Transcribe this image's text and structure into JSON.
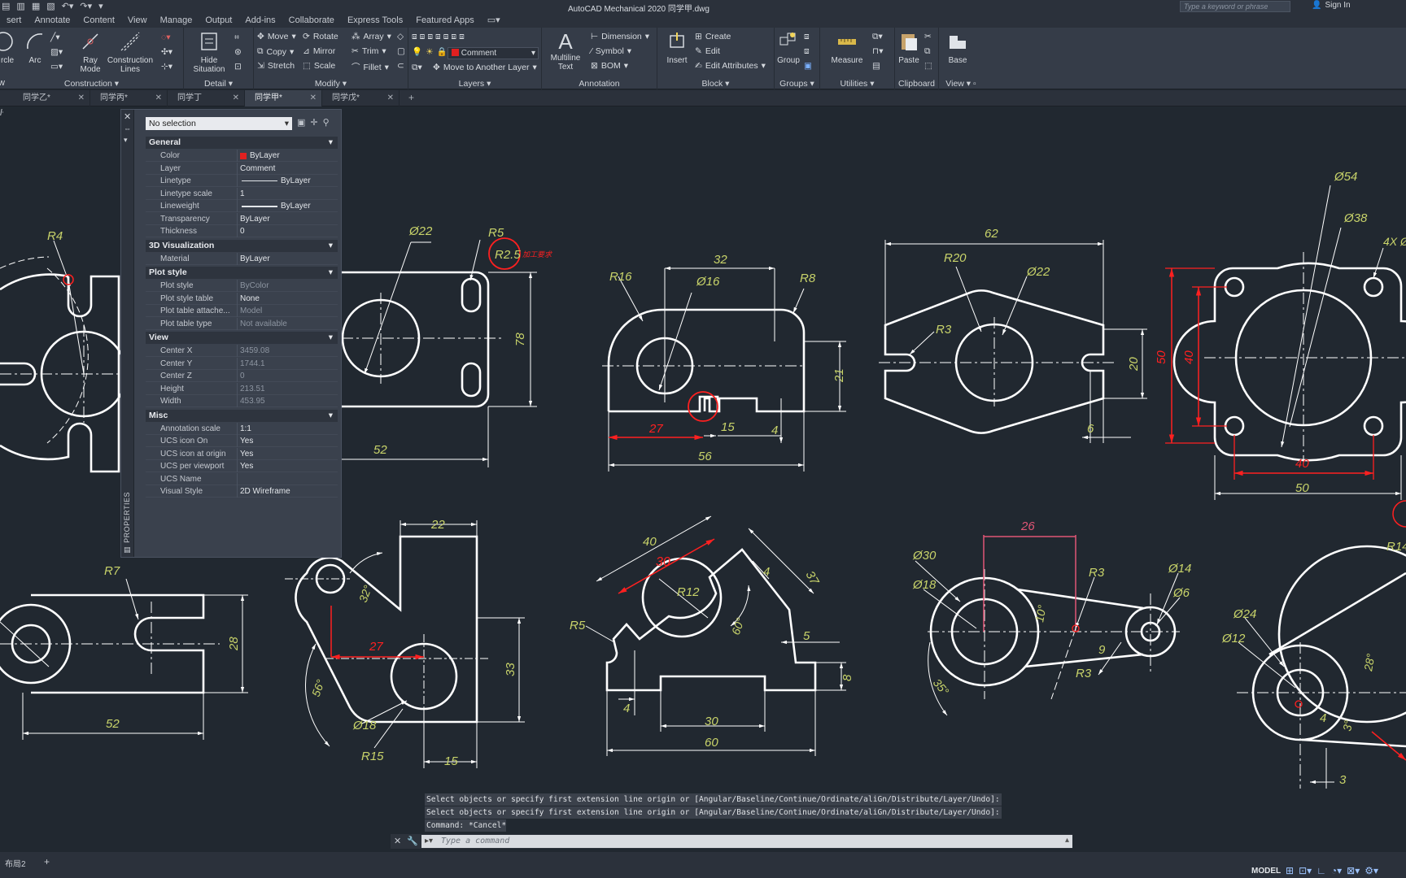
{
  "titlebar": {
    "title": "AutoCAD Mechanical 2020    同学甲.dwg",
    "search_placeholder": "Type a keyword or phrase",
    "signin": "Sign In"
  },
  "menu_tabs": [
    "sert",
    "Annotate",
    "Content",
    "View",
    "Manage",
    "Output",
    "Add-ins",
    "Collaborate",
    "Express Tools",
    "Featured Apps"
  ],
  "ribbon": {
    "construction": {
      "title": "Construction",
      "circle": "rcle",
      "arc": "Arc",
      "ray": "Ray\nMode",
      "lines": "Construction\nLines"
    },
    "detail": {
      "title": "Detail",
      "hide": "Hide\nSituation"
    },
    "modify": {
      "title": "Modify",
      "move": "Move",
      "rotate": "Rotate",
      "array": "Array",
      "copy": "Copy",
      "mirror": "Mirror",
      "trim": "Trim",
      "stretch": "Stretch",
      "scale": "Scale",
      "fillet": "Fillet"
    },
    "layers": {
      "title": "Layers",
      "current": "Comment",
      "move_layer": "Move to Another Layer"
    },
    "annotation": {
      "title": "Annotation",
      "mtext": "Multiline\nText",
      "dimension": "Dimension",
      "symbol": "Symbol",
      "bom": "BOM"
    },
    "block": {
      "title": "Block",
      "insert": "Insert",
      "create": "Create",
      "edit": "Edit",
      "edit_attr": "Edit Attributes"
    },
    "groups": {
      "title": "Groups",
      "group": "Group"
    },
    "utilities": {
      "title": "Utilities",
      "measure": "Measure"
    },
    "clipboard": {
      "title": "Clipboard",
      "paste": "Paste"
    },
    "view": {
      "title": "View",
      "base": "Base"
    },
    "left_label": "w"
  },
  "doc_tabs": [
    {
      "label": "同学乙*",
      "active": false
    },
    {
      "label": "同学丙*",
      "active": false
    },
    {
      "label": "同学丁",
      "active": false
    },
    {
      "label": "同学甲*",
      "active": true
    },
    {
      "label": "同学戊*",
      "active": false
    }
  ],
  "properties": {
    "selection": "No selection",
    "side_label": "PROPERTIES",
    "general": {
      "title": "General",
      "rows": [
        {
          "k": "Color",
          "v": "ByLayer"
        },
        {
          "k": "Layer",
          "v": "Comment"
        },
        {
          "k": "Linetype",
          "v": "ByLayer"
        },
        {
          "k": "Linetype scale",
          "v": "1"
        },
        {
          "k": "Lineweight",
          "v": "ByLayer"
        },
        {
          "k": "Transparency",
          "v": "ByLayer"
        },
        {
          "k": "Thickness",
          "v": "0"
        }
      ]
    },
    "viz": {
      "title": "3D Visualization",
      "rows": [
        {
          "k": "Material",
          "v": "ByLayer"
        }
      ]
    },
    "plot": {
      "title": "Plot style",
      "rows": [
        {
          "k": "Plot style",
          "v": "ByColor"
        },
        {
          "k": "Plot style table",
          "v": "None"
        },
        {
          "k": "Plot table attache...",
          "v": "Model"
        },
        {
          "k": "Plot table type",
          "v": "Not available"
        }
      ]
    },
    "view": {
      "title": "View",
      "rows": [
        {
          "k": "Center X",
          "v": "3459.08"
        },
        {
          "k": "Center Y",
          "v": "1744.1"
        },
        {
          "k": "Center Z",
          "v": "0"
        },
        {
          "k": "Height",
          "v": "213.51"
        },
        {
          "k": "Width",
          "v": "453.95"
        }
      ]
    },
    "misc": {
      "title": "Misc",
      "rows": [
        {
          "k": "Annotation scale",
          "v": "1:1"
        },
        {
          "k": "UCS icon On",
          "v": "Yes"
        },
        {
          "k": "UCS icon at origin",
          "v": "Yes"
        },
        {
          "k": "UCS per viewport",
          "v": "Yes"
        },
        {
          "k": "UCS Name",
          "v": ""
        },
        {
          "k": "Visual Style",
          "v": "2D Wireframe"
        }
      ]
    }
  },
  "command": {
    "history": [
      "Select objects or specify first extension line origin or [Angular/Baseline/Continue/Ordinate/aliGn/Distribute/Layer/Undo]:",
      "Select objects or specify first extension line origin or [Angular/Baseline/Continue/Ordinate/aliGn/Distribute/Layer/Undo]:",
      "Command: *Cancel*"
    ],
    "placeholder": "Type a command"
  },
  "statusbar": {
    "layout": "布局2",
    "model": "MODEL"
  },
  "dims": {
    "d1": {
      "r4": "R4"
    },
    "d2": {
      "d22": "Ø22",
      "r5": "R5",
      "r25": "R2.5",
      "h78": "78",
      "w52": "52",
      "note": "加工要求"
    },
    "d3": {
      "w32": "32",
      "r16": "R16",
      "d16": "Ø16",
      "r8": "R8",
      "h21": "21",
      "w27": "27",
      "w15": "15",
      "h4": "4",
      "w56": "56"
    },
    "d4": {
      "w62": "62",
      "r20": "R20",
      "d22": "Ø22",
      "r3": "R3",
      "h20": "20",
      "w6": "6"
    },
    "d5": {
      "d54": "Ø54",
      "d38": "Ø38",
      "n4x": "4X Ø",
      "h50": "50",
      "h40": "40",
      "w40": "40",
      "w50": "50"
    },
    "d6": {
      "r7": "R7",
      "h28": "28",
      "w52": "52"
    },
    "d7": {
      "w22": "22",
      "a32": "32°",
      "w27": "27",
      "h33": "33",
      "a56": "56°",
      "d18": "Ø18",
      "r15": "R15",
      "w15": "15"
    },
    "d8": {
      "w40": "40",
      "w30r": "30",
      "r12": "R12",
      "w4": "4",
      "w37": "37",
      "r5": "R5",
      "a60": "60°",
      "w5": "5",
      "h8": "8",
      "h4": "4",
      "w30": "30",
      "w60": "60"
    },
    "d9": {
      "w26": "26",
      "d30": "Ø30",
      "d18": "Ø18",
      "r3a": "R3",
      "d14": "Ø14",
      "d6": "Ø6",
      "a10": "10°",
      "a35": "35°",
      "w9": "9",
      "r3b": "R3"
    },
    "d10": {
      "r14": "R14",
      "d24": "Ø24",
      "d12": "Ø12",
      "a28": "28°",
      "h4": "4",
      "a3": "3°",
      "w3": "3"
    }
  }
}
